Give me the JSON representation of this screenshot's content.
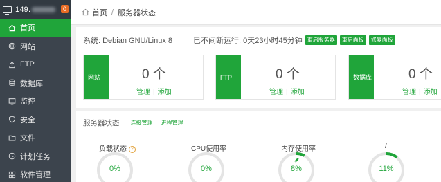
{
  "sidebar": {
    "ip": "149.",
    "badge": "0",
    "items": [
      {
        "label": "首页",
        "icon": "home-icon",
        "active": true
      },
      {
        "label": "网站",
        "icon": "globe-icon"
      },
      {
        "label": "FTP",
        "icon": "upload-icon"
      },
      {
        "label": "数据库",
        "icon": "database-icon"
      },
      {
        "label": "监控",
        "icon": "monitor-icon"
      },
      {
        "label": "安全",
        "icon": "shield-icon"
      },
      {
        "label": "文件",
        "icon": "folder-icon"
      },
      {
        "label": "计划任务",
        "icon": "clock-icon"
      },
      {
        "label": "软件管理",
        "icon": "grid-icon"
      }
    ]
  },
  "breadcrumb": {
    "home": "首页",
    "separator": "/",
    "current": "服务器状态"
  },
  "system": {
    "os": "系统: Debian GNU/Linux 8",
    "uptime": "已不间断运行: 0天23小时45分钟",
    "buttons": [
      "重启服务器",
      "重启面板",
      "修复面板"
    ]
  },
  "cards": [
    {
      "tab": "网站",
      "count": "0 个",
      "manage": "管理",
      "add": "添加"
    },
    {
      "tab": "FTP",
      "count": "0 个",
      "manage": "管理",
      "add": "添加"
    },
    {
      "tab": "数据库",
      "count": "0 个",
      "manage": "管理",
      "add": "添加"
    }
  ],
  "status": {
    "title": "服务器状态",
    "links": [
      "连接管理",
      "进程管理"
    ],
    "gauges": [
      {
        "label": "负载状态",
        "value": "0%",
        "percent": 0
      },
      {
        "label": "CPU使用率",
        "value": "0%",
        "percent": 0
      },
      {
        "label": "内存使用率",
        "value": "8%",
        "percent": 8
      },
      {
        "label": "/",
        "value": "11%",
        "percent": 11
      }
    ]
  },
  "colors": {
    "accent": "#20a53a",
    "sidebar": "#3c444d",
    "warning": "#e96c24",
    "gauge_track": "#e4e4e4"
  }
}
